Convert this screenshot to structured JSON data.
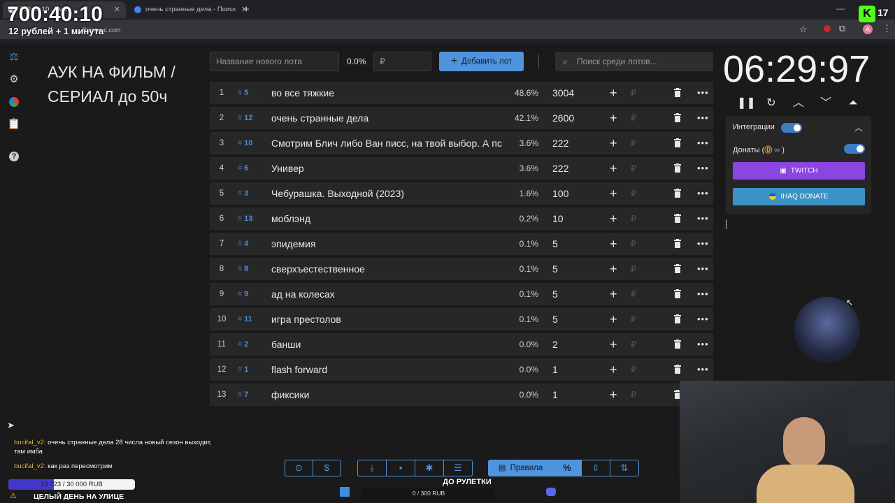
{
  "browser": {
    "tabs": [
      {
        "label": "700:40:10 ... мм"
      },
      {
        "label": "очень странные дела - Поиск"
      }
    ],
    "url": "Pointauc.com",
    "profile_initial": "A"
  },
  "overlay": {
    "timer": "700:40:10",
    "subtitle": "12 рублей + 1 минута",
    "kick_count": "17"
  },
  "app": {
    "title": "АУК НА ФИЛЬМ / СЕРИАЛ до 50ч",
    "new_lot_placeholder": "Название нового лота",
    "percent_value": "0.0%",
    "amount_placeholder": "₽",
    "add_button": "Добавить лот",
    "search_placeholder": "Поиск среди лотов...",
    "sidebar_icons": [
      "gavel-icon",
      "gear-icon",
      "pie-chart-icon",
      "clipboard-icon",
      "help-icon"
    ]
  },
  "lots": [
    {
      "n": "1",
      "id": "5",
      "name": "во все тяжкие",
      "pct": "48.6%",
      "amount": "3004"
    },
    {
      "n": "2",
      "id": "12",
      "name": "очень странные дела",
      "pct": "42.1%",
      "amount": "2600"
    },
    {
      "n": "3",
      "id": "10",
      "name": "Смотрим Блич либо Ван писс, на твой выбор. А пс",
      "pct": "3.6%",
      "amount": "222"
    },
    {
      "n": "4",
      "id": "6",
      "name": "Универ",
      "pct": "3.6%",
      "amount": "222"
    },
    {
      "n": "5",
      "id": "3",
      "name": "Чебурашка. Выходной (2023)",
      "pct": "1.6%",
      "amount": "100"
    },
    {
      "n": "6",
      "id": "13",
      "name": "моблэнд",
      "pct": "0.2%",
      "amount": "10"
    },
    {
      "n": "7",
      "id": "4",
      "name": "эпидемия",
      "pct": "0.1%",
      "amount": "5"
    },
    {
      "n": "8",
      "id": "8",
      "name": "сверхъестественное",
      "pct": "0.1%",
      "amount": "5"
    },
    {
      "n": "9",
      "id": "9",
      "name": "ад на колесах",
      "pct": "0.1%",
      "amount": "5"
    },
    {
      "n": "10",
      "id": "11",
      "name": "игра престолов",
      "pct": "0.1%",
      "amount": "5"
    },
    {
      "n": "11",
      "id": "2",
      "name": "банши",
      "pct": "0.0%",
      "amount": "2"
    },
    {
      "n": "12",
      "id": "1",
      "name": "flash forward",
      "pct": "0.0%",
      "amount": "1"
    },
    {
      "n": "13",
      "id": "7",
      "name": "фиксики",
      "pct": "0.0%",
      "amount": "1"
    }
  ],
  "timer_panel": {
    "time": "06:29:97",
    "integrations_label": "Интеграции",
    "donations_label": "Донаты (",
    "donations_suffix": ")",
    "twitch_label": "TWITCH",
    "ihaq_label": "IHAQ DONATE"
  },
  "chat": [
    {
      "user": "bucifal_v2:",
      "text": "очень странные дела 28 числа новый сезон выходит, там имба"
    },
    {
      "user": "bucifal_v2:",
      "text": "как раз пересмотрим"
    }
  ],
  "goal": {
    "text": "10 723 / 30 000 RUB",
    "progress": 0.357
  },
  "stream_status": "ЦЕЛЫЙ ДЕНЬ НА УЛИЦЕ",
  "bottom_toolbar": {
    "rules_label": "Правила",
    "percent_symbol": "%"
  },
  "roulette": {
    "title": "ДО РУЛЕТКИ",
    "progress_text": "0 / 300 RUB"
  },
  "colors": {
    "accent": "#4f94dc",
    "twitch": "#8b45e0",
    "ihaq": "#3b93c3",
    "bg": "#1a1a1a",
    "row": "#272727"
  }
}
